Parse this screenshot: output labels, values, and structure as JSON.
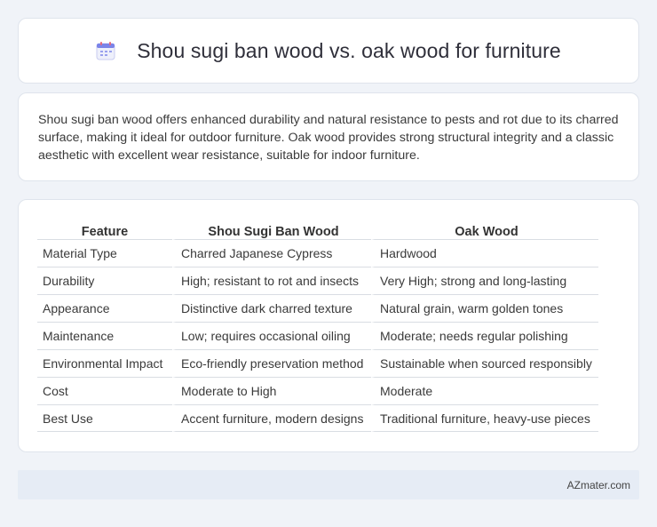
{
  "header": {
    "icon": "calendar-icon",
    "title": "Shou sugi ban wood vs. oak wood for furniture"
  },
  "summary": {
    "text": "Shou sugi ban wood offers enhanced durability and natural resistance to pests and rot due to its charred surface, making it ideal for outdoor furniture. Oak wood provides strong structural integrity and a classic aesthetic with excellent wear resistance, suitable for indoor furniture."
  },
  "table": {
    "headers": [
      "Feature",
      "Shou Sugi Ban Wood",
      "Oak Wood"
    ],
    "rows": [
      [
        "Material Type",
        "Charred Japanese Cypress",
        "Hardwood"
      ],
      [
        "Durability",
        "High; resistant to rot and insects",
        "Very High; strong and long-lasting"
      ],
      [
        "Appearance",
        "Distinctive dark charred texture",
        "Natural grain, warm golden tones"
      ],
      [
        "Maintenance",
        "Low; requires occasional oiling",
        "Moderate; needs regular polishing"
      ],
      [
        "Environmental Impact",
        "Eco-friendly preservation method",
        "Sustainable when sourced responsibly"
      ],
      [
        "Cost",
        "Moderate to High",
        "Moderate"
      ],
      [
        "Best Use",
        "Accent furniture, modern designs",
        "Traditional furniture, heavy-use pieces"
      ]
    ]
  },
  "footer": {
    "source": "AZmater.com"
  },
  "colors": {
    "background": "#f0f3f8",
    "card": "#ffffff",
    "footer": "#e6ecf5"
  }
}
